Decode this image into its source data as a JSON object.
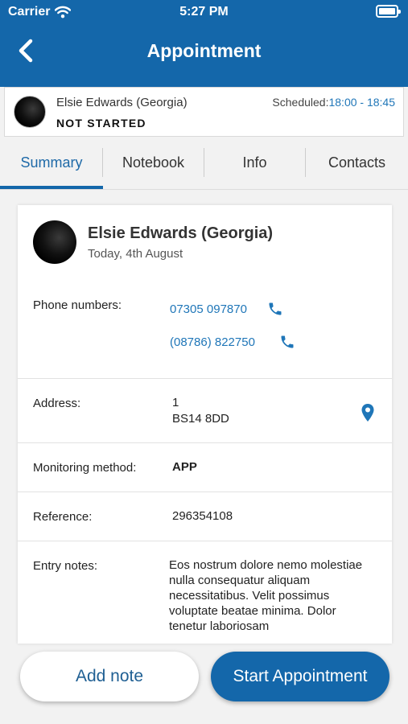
{
  "status_bar": {
    "carrier": "Carrier",
    "time": "5:27 PM"
  },
  "nav": {
    "title": "Appointment"
  },
  "appointment_header": {
    "name": "Elsie Edwards (Georgia)",
    "status": "NOT STARTED",
    "scheduled_label": "Scheduled:",
    "scheduled_time": "18:00 - 18:45"
  },
  "tabs": [
    {
      "label": "Summary"
    },
    {
      "label": "Notebook"
    },
    {
      "label": "Info"
    },
    {
      "label": "Contacts"
    }
  ],
  "summary": {
    "name": "Elsie Edwards (Georgia)",
    "date": "Today, 4th August",
    "phone_label": "Phone numbers:",
    "phones": [
      "07305 097870",
      "(08786) 822750"
    ],
    "address_label": "Address:",
    "address_lines": [
      "1",
      "BS14 8DD"
    ],
    "monitoring_label": "Monitoring method:",
    "monitoring_value": "APP",
    "reference_label": "Reference:",
    "reference_value": "296354108",
    "entry_label": "Entry notes:",
    "entry_value": "Eos nostrum dolore nemo molestiae nulla consequatur aliquam necessitatibus. Velit possimus voluptate beatae minima. Dolor tenetur laboriosam"
  },
  "actions": {
    "add_note": "Add note",
    "start": "Start Appointment"
  },
  "colors": {
    "primary": "#1467aa",
    "link": "#1f76b8",
    "background": "#f2f2f2"
  }
}
